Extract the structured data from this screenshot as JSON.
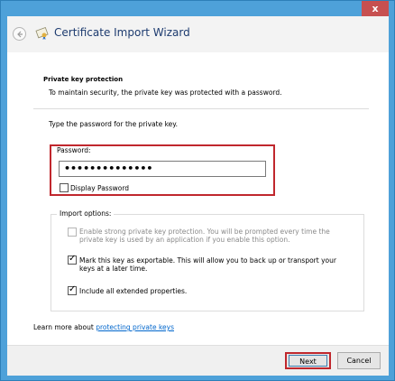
{
  "window": {
    "close_glyph": "x"
  },
  "header": {
    "title": "Certificate Import Wizard",
    "back_icon": "back-arrow-icon",
    "app_icon": "certificate-icon"
  },
  "content": {
    "section_title": "Private key protection",
    "section_description": "To maintain security, the private key was protected with a password.",
    "type_prompt": "Type the password for the private key.",
    "password": {
      "label": "Password:",
      "value": "••••••••••••••",
      "display_password_label": "Display Password",
      "display_password_checked": false
    },
    "import_options": {
      "label": "Import options:",
      "options": [
        {
          "line1": "Enable strong private key protection. You will be prompted every time the",
          "line2": "private key is used by an application if you enable this option.",
          "checked": false,
          "enabled": false
        },
        {
          "line1": "Mark this key as exportable. This will allow you to back up or transport your",
          "line2": "keys at a later time.",
          "checked": true,
          "enabled": true
        },
        {
          "line1": "Include all extended properties.",
          "line2": "",
          "checked": true,
          "enabled": true
        }
      ]
    },
    "learn_more_prefix": "Learn more about ",
    "learn_more_link": "protecting private keys"
  },
  "footer": {
    "next_label": "Next",
    "cancel_label": "Cancel"
  },
  "colors": {
    "title_bar": "#4ea1d9",
    "close_button": "#c75050",
    "highlight_box": "#c0272d",
    "link": "#0066cc"
  }
}
